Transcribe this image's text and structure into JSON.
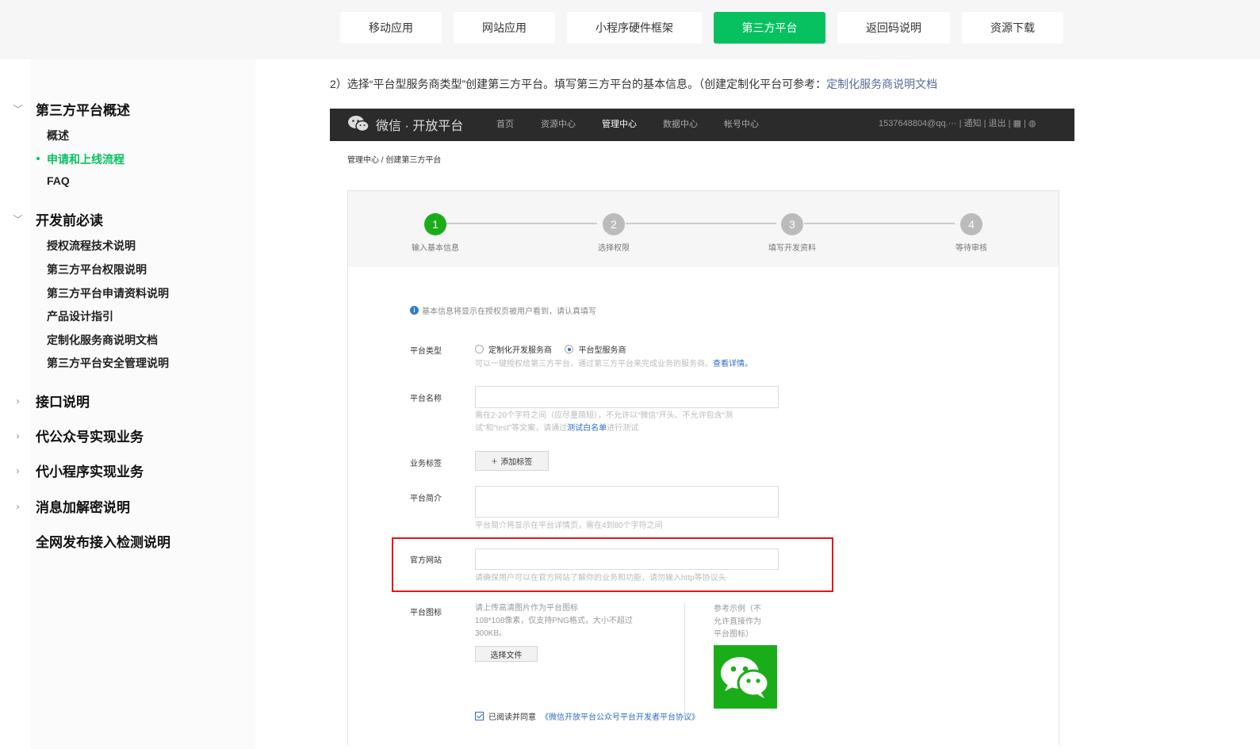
{
  "top_nav": {
    "tabs": [
      {
        "label": "移动应用"
      },
      {
        "label": "网站应用"
      },
      {
        "label": "小程序硬件框架"
      },
      {
        "label": "第三方平台",
        "active": true
      },
      {
        "label": "返回码说明"
      },
      {
        "label": "资源下载"
      }
    ]
  },
  "sidebar": {
    "sections": [
      {
        "label": "第三方平台概述",
        "expanded": true,
        "items": [
          {
            "label": "概述"
          },
          {
            "label": "申请和上线流程",
            "active": true
          },
          {
            "label": "FAQ"
          }
        ]
      },
      {
        "label": "开发前必读",
        "expanded": true,
        "items": [
          {
            "label": "授权流程技术说明"
          },
          {
            "label": "第三方平台权限说明"
          },
          {
            "label": "第三方平台申请资料说明"
          },
          {
            "label": "产品设计指引"
          },
          {
            "label": "定制化服务商说明文档"
          },
          {
            "label": "第三方平台安全管理说明"
          }
        ]
      },
      {
        "label": "接口说明",
        "expanded": false
      },
      {
        "label": "代公众号实现业务",
        "expanded": false
      },
      {
        "label": "代小程序实现业务",
        "expanded": false
      },
      {
        "label": "消息加解密说明",
        "expanded": false
      },
      {
        "label": "全网发布接入检测说明",
        "expanded": false
      }
    ]
  },
  "content": {
    "intro_text": "2）选择“平台型服务商类型”创建第三方平台。填写第三方平台的基本信息。（创建定制化平台可参考：",
    "intro_link": "定制化服务商说明文档"
  },
  "screenshot": {
    "header": {
      "brand": "微信 · 开放平台",
      "nav": [
        "首页",
        "资源中心",
        "管理中心",
        "数据中心",
        "帐号中心"
      ],
      "active_nav": "管理中心",
      "account": "1537648804@qq.···  |  通知  |  退出  |  ▦  |  ◍"
    },
    "breadcrumb": "管理中心 / 创建第三方平台",
    "steps": [
      {
        "num": "1",
        "label": "输入基本信息",
        "done": true
      },
      {
        "num": "2",
        "label": "选择权限",
        "done": false
      },
      {
        "num": "3",
        "label": "填写开发资料",
        "done": false
      },
      {
        "num": "4",
        "label": "等待审核",
        "done": false
      }
    ],
    "info_text": "基本信息将显示在授权页被用户看到，请认真填写",
    "form": {
      "platform_type": {
        "label": "平台类型",
        "options": [
          "定制化开发服务商",
          "平台型服务商"
        ],
        "selected": "平台型服务商",
        "hint": "可以一键授权给第三方平台，通过第三方平台来完成业务的服务商。",
        "hint_link": "查看详情。"
      },
      "platform_name": {
        "label": "平台名称",
        "value": "",
        "hint_line1": "需在2-20个字符之间（应尽量简短），不允许以“微信”开头、不允许包含“测",
        "hint_line2_pre": "试”和“test”等文案，请通过",
        "hint_line2_link": "测试白名单",
        "hint_line2_post": "进行测试"
      },
      "business_tags": {
        "label": "业务标签",
        "button": "添加标签"
      },
      "platform_intro": {
        "label": "平台简介",
        "value": "",
        "hint": "平台简介将显示在平台详情页，需在4到80个字符之间"
      },
      "official_site": {
        "label": "官方网站",
        "value": "",
        "hint": "请确保用户可以在官方网站了解你的业务和功能，请勿输入http等协议头"
      },
      "platform_icon": {
        "label": "平台图标",
        "desc_lines": [
          "请上传高清图片作为平台图标",
          "108*108像素，仅支持PNG格式，大小不超过",
          "300KB。"
        ],
        "button": "选择文件",
        "sample_lines": [
          "参考示例（不",
          "允许直接作为",
          "平台图标）"
        ]
      },
      "agreement": {
        "prefix": "已阅读并同意",
        "link": "《微信开放平台公众号平台开发者平台协议》",
        "checked": true
      }
    }
  },
  "colors": {
    "brand_green": "#07c160",
    "highlight_red": "#e8141b",
    "link_blue": "#576b95"
  }
}
